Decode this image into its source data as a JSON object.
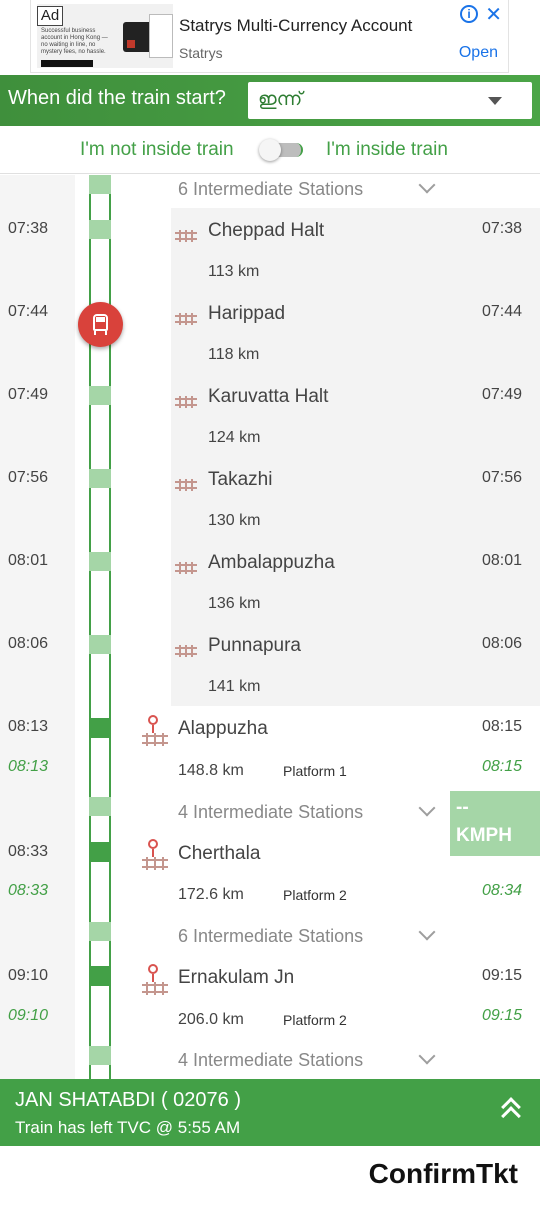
{
  "ad": {
    "badge": "Ad",
    "title": "Statrys Multi-Currency Account",
    "brand": "Statrys",
    "cta": "Open",
    "thumb_text": "Successful business account in Hong Kong — no waiting in line, no mystery fees, no hassle."
  },
  "header": {
    "question": "When did the train start?",
    "day_value": "ഇന്ന്"
  },
  "toggle": {
    "left_label": "I'm not inside train",
    "right_label": "I'm inside train",
    "state": "off"
  },
  "timeline": {
    "intermediate_top": "6 Intermediate Stations",
    "intermediate_stations": [
      {
        "time": "07:38",
        "name": "Cheppad Halt",
        "km": "113 km",
        "right_time": "07:38"
      },
      {
        "time": "07:44",
        "name": "Harippad",
        "km": "118 km",
        "right_time": "07:44"
      },
      {
        "time": "07:49",
        "name": "Karuvatta Halt",
        "km": "124 km",
        "right_time": "07:49"
      },
      {
        "time": "07:56",
        "name": "Takazhi",
        "km": "130 km",
        "right_time": "07:56"
      },
      {
        "time": "08:01",
        "name": "Ambalappuzha",
        "km": "136 km",
        "right_time": "08:01"
      },
      {
        "time": "08:06",
        "name": "Punnapura",
        "km": "141 km",
        "right_time": "08:06"
      }
    ],
    "major_stations": [
      {
        "arr": "08:13",
        "arr_actual": "08:13",
        "name": "Alappuzha",
        "km": "148.8 km",
        "platform": "Platform 1",
        "dep": "08:15",
        "dep_actual": "08:15",
        "intermediate_after": "4 Intermediate Stations"
      },
      {
        "arr": "08:33",
        "arr_actual": "08:33",
        "name": "Cherthala",
        "km": "172.6 km",
        "platform": "Platform 2",
        "dep": "08:34",
        "dep_actual": "08:34",
        "intermediate_after": "6 Intermediate Stations"
      },
      {
        "arr": "09:10",
        "arr_actual": "09:10",
        "name": "Ernakulam Jn",
        "km": "206.0 km",
        "platform": "Platform 2",
        "dep": "09:15",
        "dep_actual": "09:15",
        "intermediate_after": "4 Intermediate Stations"
      }
    ],
    "speed": {
      "value": "--",
      "unit": "KMPH"
    }
  },
  "bottom": {
    "train_name": "JAN SHATABDI ( 02076 )",
    "status": "Train has left TVC @ 5:55 AM"
  },
  "footer": {
    "brand": "ConfirmTkt"
  },
  "colors": {
    "accent": "#43a047",
    "light_accent": "#a5d6a7",
    "marker": "#d9423b",
    "link": "#1a73e8"
  }
}
